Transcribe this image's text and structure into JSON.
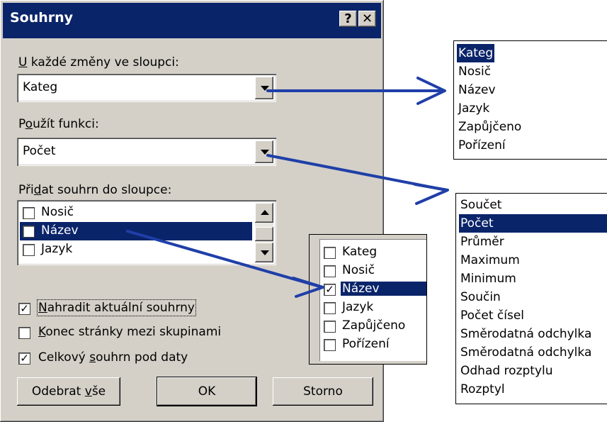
{
  "dialog": {
    "title": "Souhrny",
    "help_label": "?",
    "close_label": "✕",
    "group_by": {
      "label_key": "U",
      "label_rest": " každé změny ve sloupci:",
      "value": "Kateg"
    },
    "function": {
      "label_pre": "P",
      "label_key": "o",
      "label_rest": "užít funkci:",
      "value": "Počet"
    },
    "add_to": {
      "label_pre": "Při",
      "label_key": "d",
      "label_rest": "at souhrn do sloupce:",
      "items": [
        {
          "label": "Nosič",
          "checked": false
        },
        {
          "label": "Název",
          "checked": true
        },
        {
          "label": "Jazyk",
          "checked": false
        }
      ]
    },
    "options": [
      {
        "key": "N",
        "rest": "ahradit aktuální souhrny",
        "checked": true
      },
      {
        "key": "K",
        "rest": "onec stránky mezi skupinami",
        "checked": false
      },
      {
        "pre": "Celkový ",
        "key": "s",
        "rest": "ouhrn pod daty",
        "checked": true
      }
    ],
    "buttons": {
      "remove_pre": "Odebrat ",
      "remove_key": "v",
      "remove_rest": "še",
      "ok": "OK",
      "cancel": "Storno"
    }
  },
  "popup_columns": {
    "items": [
      "Kateg",
      "Nosič",
      "Název",
      "Jazyk",
      "Zapůjčeno",
      "Pořízení"
    ],
    "selected_index": 0
  },
  "popup_functions": {
    "items": [
      "Součet",
      "Počet",
      "Průměr",
      "Maximum",
      "Minimum",
      "Součin",
      "Počet čísel",
      "Směrodatná odchylka",
      "Směrodatná odchylka",
      "Odhad rozptylu",
      "Rozptyl"
    ],
    "selected_index": 1
  },
  "popup_checklist": {
    "items": [
      {
        "label": "Kateg",
        "checked": false
      },
      {
        "label": "Nosič",
        "checked": false
      },
      {
        "label": "Název",
        "checked": true
      },
      {
        "label": "Jazyk",
        "checked": false
      },
      {
        "label": "Zapůjčeno",
        "checked": false
      },
      {
        "label": "Pořízení",
        "checked": false
      }
    ],
    "selected_index": 2
  },
  "colors": {
    "arrow": "#1f3fa8",
    "selection": "#0a246a",
    "face": "#d4d0c8"
  }
}
